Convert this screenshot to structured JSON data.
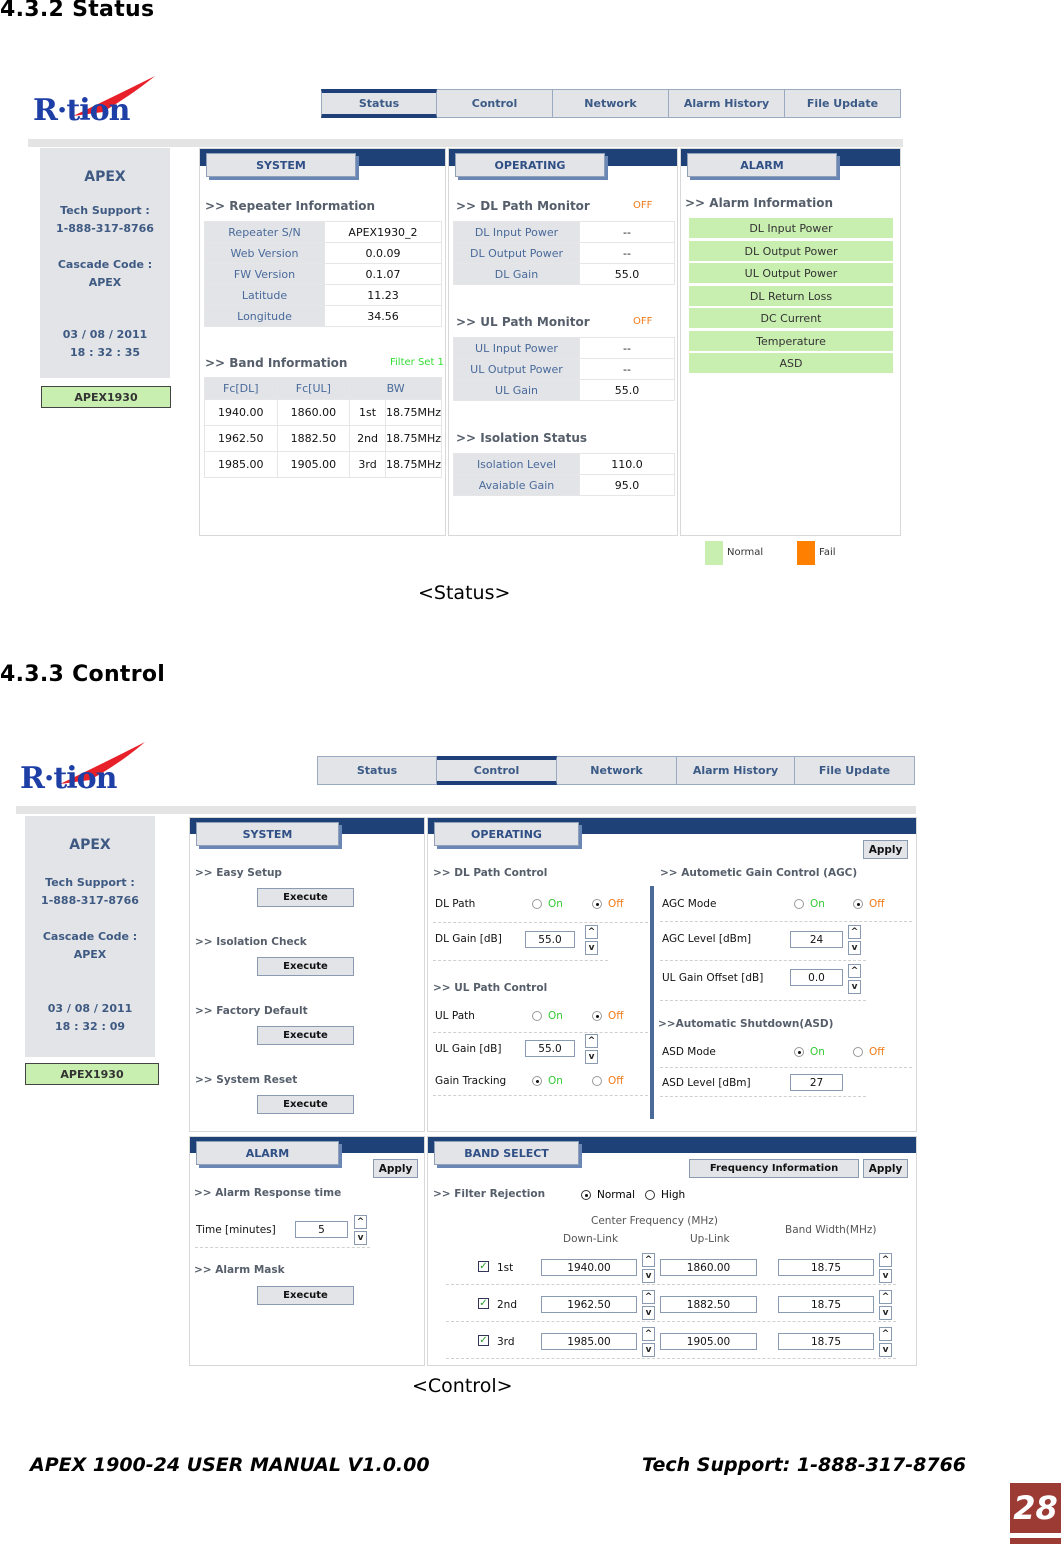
{
  "status_section": {
    "heading": "4.3.2  Status",
    "caption": "<Status>",
    "logo_text": "R·tion",
    "nav_tabs": [
      "Status",
      "Control",
      "Network",
      "Alarm History",
      "File Update"
    ],
    "active_tab": "Status",
    "sidebar": {
      "brand": "APEX",
      "tech_support_label": "Tech Support :",
      "tech_support_phone": "1-888-317-8766",
      "cascade_label": "Cascade Code :",
      "cascade_value": "APEX",
      "date": "03 / 08 / 2011",
      "time": "18 : 32 : 35",
      "model": "APEX1930"
    },
    "system_panel": {
      "tab_label": "SYSTEM",
      "repeater_info_title": ">> Repeater Information",
      "repeater_info": [
        {
          "key": "Repeater S/N",
          "value": "APEX1930_2"
        },
        {
          "key": "Web Version",
          "value": "0.0.09"
        },
        {
          "key": "FW Version",
          "value": "0.1.07"
        },
        {
          "key": "Latitude",
          "value": "11.23"
        },
        {
          "key": "Longitude",
          "value": "34.56"
        }
      ],
      "band_info_title": ">> Band Information",
      "filter_set": "Filter Set 1",
      "band_headers": [
        "Fc[DL]",
        "Fc[UL]",
        "BW"
      ],
      "band_rows": [
        {
          "dl": "1940.00",
          "ul": "1860.00",
          "idx": "1st",
          "bw": "18.75MHz"
        },
        {
          "dl": "1962.50",
          "ul": "1882.50",
          "idx": "2nd",
          "bw": "18.75MHz"
        },
        {
          "dl": "1985.00",
          "ul": "1905.00",
          "idx": "3rd",
          "bw": "18.75MHz"
        }
      ]
    },
    "operating_panel": {
      "tab_label": "OPERATING",
      "dl_title": ">> DL Path Monitor",
      "dl_state": "OFF",
      "dl_rows": [
        {
          "key": "DL Input Power",
          "value": "--"
        },
        {
          "key": "DL Output Power",
          "value": "--"
        },
        {
          "key": "DL Gain",
          "value": "55.0"
        }
      ],
      "ul_title": ">> UL Path Monitor",
      "ul_state": "OFF",
      "ul_rows": [
        {
          "key": "UL Input Power",
          "value": "--"
        },
        {
          "key": "UL Output Power",
          "value": "--"
        },
        {
          "key": "UL Gain",
          "value": "55.0"
        }
      ],
      "iso_title": ">> Isolation Status",
      "iso_rows": [
        {
          "key": "Isolation Level",
          "value": "110.0"
        },
        {
          "key": "Avaiable Gain",
          "value": "95.0"
        }
      ]
    },
    "alarm_panel": {
      "tab_label": "ALARM",
      "title": ">> Alarm Information",
      "items": [
        "DL Input Power",
        "DL Output Power",
        "UL Output Power",
        "DL Return Loss",
        "DC Current",
        "Temperature",
        "ASD"
      ],
      "item_state": "normal"
    },
    "legend": {
      "normal_label": "Normal",
      "fail_label": "Fail",
      "normal_color": "#c8eeb0",
      "fail_color": "#ff8000"
    }
  },
  "control_section": {
    "heading": "4.3.3  Control",
    "caption": "<Control>",
    "logo_text": "R·tion",
    "nav_tabs": [
      "Status",
      "Control",
      "Network",
      "Alarm History",
      "File Update"
    ],
    "active_tab": "Control",
    "sidebar": {
      "brand": "APEX",
      "tech_support_label": "Tech Support :",
      "tech_support_phone": "1-888-317-8766",
      "cascade_label": "Cascade Code :",
      "cascade_value": "APEX",
      "date": "03 / 08 / 2011",
      "time": "18 : 32 : 09",
      "model": "APEX1930"
    },
    "system_panel": {
      "tab_label": "SYSTEM",
      "actions": [
        {
          "title": ">> Easy Setup",
          "button": "Execute"
        },
        {
          "title": ">> Isolation Check",
          "button": "Execute"
        },
        {
          "title": ">> Factory Default",
          "button": "Execute"
        },
        {
          "title": ">> System Reset",
          "button": "Execute"
        }
      ]
    },
    "operating_panel": {
      "tab_label": "OPERATING",
      "apply_label": "Apply",
      "dl_title": ">> DL Path Control",
      "dl_path_label": "DL Path",
      "dl_path_selected": "Off",
      "dl_gain_label": "DL Gain [dB]",
      "dl_gain_value": "55.0",
      "ul_title": ">> UL Path Control",
      "ul_path_label": "UL Path",
      "ul_path_selected": "Off",
      "ul_gain_label": "UL Gain [dB]",
      "ul_gain_value": "55.0",
      "gain_tracking_label": "Gain Tracking",
      "gain_tracking_selected": "On",
      "on_label": "On",
      "off_label": "Off",
      "agc_title": ">> Autometic Gain Control (AGC)",
      "agc_mode_label": "AGC Mode",
      "agc_mode_selected": "Off",
      "agc_level_label": "AGC Level [dBm]",
      "agc_level_value": "24",
      "ul_gain_offset_label": "UL Gain Offset [dB]",
      "ul_gain_offset_value": "0.0",
      "asd_title": ">>Automatic Shutdown(ASD)",
      "asd_mode_label": "ASD Mode",
      "asd_mode_selected": "On",
      "asd_level_label": "ASD Level [dBm]",
      "asd_level_value": "27",
      "spin_up": "^",
      "spin_down": "v"
    },
    "alarm_panel": {
      "tab_label": "ALARM",
      "apply_label": "Apply",
      "response_title": ">> Alarm Response time",
      "time_label": "Time [minutes]",
      "time_value": "5",
      "mask_title": ">> Alarm Mask",
      "mask_button": "Execute"
    },
    "band_panel": {
      "tab_label": "BAND SELECT",
      "freq_info_label": "Frequency Information",
      "apply_label": "Apply",
      "filter_title": ">> Filter Rejection",
      "filter_options": [
        "Normal",
        "High"
      ],
      "filter_selected": "Normal",
      "center_freq_header": "Center Frequency (MHz)",
      "downlink_header": "Down-Link",
      "uplink_header": "Up-Link",
      "bw_header": "Band Width(MHz)",
      "rows": [
        {
          "label": "1st",
          "checked": true,
          "dl": "1940.00",
          "ul": "1860.00",
          "bw": "18.75"
        },
        {
          "label": "2nd",
          "checked": true,
          "dl": "1962.50",
          "ul": "1882.50",
          "bw": "18.75"
        },
        {
          "label": "3rd",
          "checked": true,
          "dl": "1985.00",
          "ul": "1905.00",
          "bw": "18.75"
        }
      ]
    }
  },
  "footer": {
    "left": "APEX 1900-24 USER MANUAL V1.0.00",
    "right": "Tech Support: 1-888-317-8766",
    "page_number": "28"
  }
}
